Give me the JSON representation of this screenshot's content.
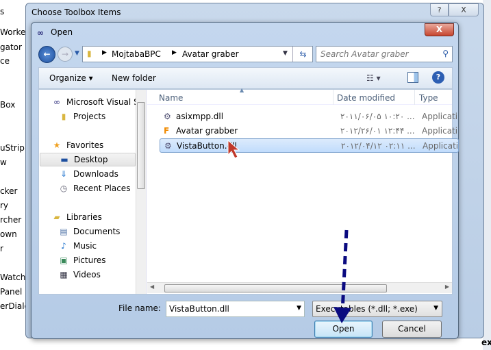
{
  "background": {
    "left_items": [
      "s",
      "Worker",
      "gator",
      "ce",
      "Box",
      "uStrip",
      "w",
      "cker",
      "ry",
      "rcher",
      "own",
      "r",
      "Watcher",
      "Panel",
      "erDialo"
    ],
    "right_bottom": "ext"
  },
  "outer_dialog": {
    "title": "Choose Toolbox Items",
    "help": "?",
    "close": "X"
  },
  "open_dialog": {
    "title": "Open",
    "close": "X",
    "breadcrumb": [
      "MojtabaBPC",
      "Avatar graber"
    ],
    "search_placeholder": "Search Avatar graber",
    "toolbar": {
      "organize": "Organize",
      "new_folder": "New folder"
    },
    "nav": [
      {
        "label": "Microsoft Visual St",
        "icon": "vs-icon",
        "level": 0
      },
      {
        "label": "Projects",
        "icon": "folder-icon",
        "level": 1
      },
      {
        "label": "Favorites",
        "icon": "star-icon",
        "level": 0
      },
      {
        "label": "Desktop",
        "icon": "desktop-icon",
        "level": 1,
        "selected": true
      },
      {
        "label": "Downloads",
        "icon": "downloads-icon",
        "level": 1
      },
      {
        "label": "Recent Places",
        "icon": "recent-icon",
        "level": 1
      },
      {
        "label": "Libraries",
        "icon": "libraries-icon",
        "level": 0
      },
      {
        "label": "Documents",
        "icon": "document-icon",
        "level": 1
      },
      {
        "label": "Music",
        "icon": "music-icon",
        "level": 1
      },
      {
        "label": "Pictures",
        "icon": "pictures-icon",
        "level": 1
      },
      {
        "label": "Videos",
        "icon": "videos-icon",
        "level": 1
      }
    ],
    "columns": [
      "Name",
      "Date modified",
      "Type"
    ],
    "files": [
      {
        "name": "asixmpp.dll",
        "date": "۲۰۱۱/۰۶/۰۵ ۱۰:۲۰ ...",
        "type": "Applicatio",
        "icon": "dll-icon"
      },
      {
        "name": "Avatar grabber",
        "date": "۲۰۱۲/۲۶/۰۱ ۱۲:۴۴ ...",
        "type": "Applicatio",
        "icon": "exe-icon"
      },
      {
        "name": "VistaButton.dll",
        "date": "۲۰۱۲/۰۴/۱۲ ۰۲:۱۱ ...",
        "type": "Applicatio",
        "icon": "dll-icon",
        "selected": true
      }
    ],
    "file_name_label": "File name:",
    "file_name_value": "VistaButton.dll",
    "filter": "Executables (*.dll; *.exe)",
    "open_button": "Open",
    "cancel_button": "Cancel"
  },
  "annotation": {
    "arrow_color": "#0a0a80"
  }
}
